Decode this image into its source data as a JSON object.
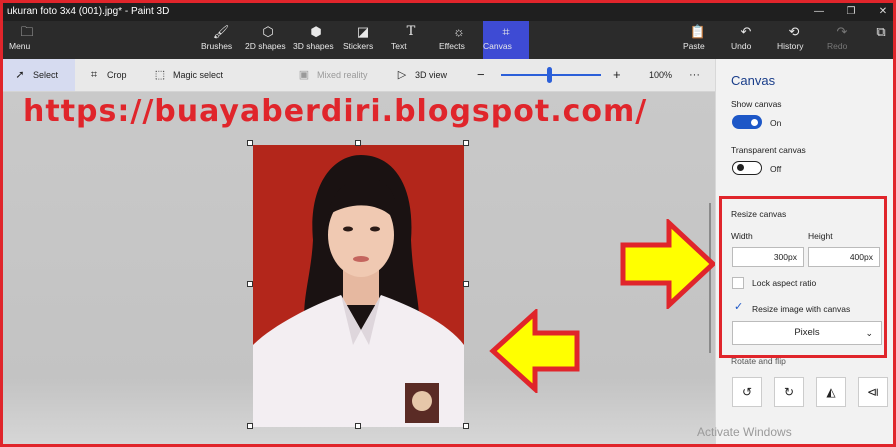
{
  "window": {
    "title": "ukuran foto 3x4 (001).jpg* - Paint 3D",
    "controls": [
      "—",
      "❐",
      "✕"
    ]
  },
  "ribbon": {
    "menu_label": "Menu",
    "tools": [
      {
        "label": "Brushes",
        "icon": "brush-icon"
      },
      {
        "label": "2D shapes",
        "icon": "2d-shapes-icon"
      },
      {
        "label": "3D shapes",
        "icon": "3d-shapes-icon"
      },
      {
        "label": "Stickers",
        "icon": "stickers-icon"
      },
      {
        "label": "Text",
        "icon": "text-icon"
      },
      {
        "label": "Effects",
        "icon": "effects-icon"
      },
      {
        "label": "Canvas",
        "icon": "canvas-icon",
        "active": true
      }
    ],
    "paste_label": "Paste",
    "undo_label": "Undo",
    "history_label": "History",
    "redo_label": "Redo"
  },
  "toolbar": {
    "select_label": "Select",
    "crop_label": "Crop",
    "magic_select_label": "Magic select",
    "mixed_reality_label": "Mixed reality",
    "view3d_label": "3D view",
    "zoom_minus": "−",
    "zoom_plus": "+",
    "zoom_level": "100%",
    "more": "···",
    "zoom_fraction": 0.48
  },
  "overlay": {
    "url_text": "https://buayaberdiri.blogspot.com/"
  },
  "panel": {
    "title": "Canvas",
    "show_canvas_label": "Show canvas",
    "show_canvas_state": "On",
    "transparent_canvas_label": "Transparent canvas",
    "transparent_canvas_state": "Off",
    "resize_canvas_label": "Resize canvas",
    "width_label": "Width",
    "height_label": "Height",
    "width_value": "300px",
    "height_value": "400px",
    "lock_aspect_label": "Lock aspect ratio",
    "resize_image_label": "Resize image with canvas",
    "units_value": "Pixels",
    "rotate_flip_label": "Rotate and flip"
  },
  "watermark": "Activate Windows",
  "colors": {
    "accent": "#1d57c7",
    "highlight_red": "#e0252b",
    "arrow_yellow": "#ffff00",
    "photo_background": "#b3261b"
  }
}
